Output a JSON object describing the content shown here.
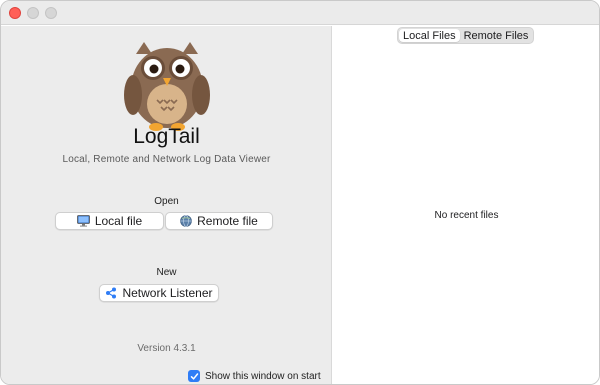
{
  "app": {
    "title": "LogTail",
    "subtitle": "Local, Remote and Network Log Data Viewer",
    "version": "Version 4.3.1"
  },
  "open_section": {
    "label": "Open",
    "local_file_label": "Local file",
    "remote_file_label": "Remote file"
  },
  "new_section": {
    "label": "New",
    "network_listener_label": "Network Listener"
  },
  "startup": {
    "show_window_label": "Show this window on start",
    "checked": true
  },
  "tabs": [
    {
      "label": "Local Files",
      "active": true
    },
    {
      "label": "Remote Files",
      "active": false
    }
  ],
  "recent": {
    "empty_text": "No recent files"
  },
  "icons": {
    "owl": "owl-logo",
    "local": "computer-icon",
    "remote": "globe-icon",
    "network": "share-icon",
    "check": "checkmark-icon"
  },
  "colors": {
    "accent": "#2f7df6",
    "close": "#ff5f57",
    "panel": "#ececec"
  }
}
